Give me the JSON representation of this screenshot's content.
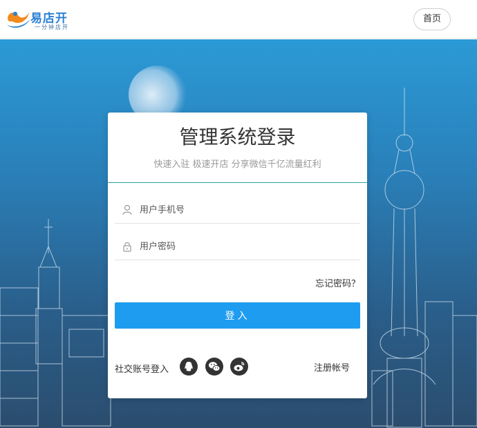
{
  "header": {
    "logo_title": "易店开",
    "logo_subtitle": "一分钟店开",
    "home_label": "首页"
  },
  "login": {
    "title": "管理系统登录",
    "subtitle": "快速入驻 极速开店 分享微信千亿流量红利",
    "username_placeholder": "用户手机号",
    "password_placeholder": "用户密码",
    "forgot_label": "忘记密码？",
    "login_label": "登入",
    "social_label": "社交账号登入",
    "register_label": "注册帐号"
  },
  "colors": {
    "accent": "#1e9cf0",
    "divider": "#2aa39b",
    "hero_top": "#2b9ad6",
    "hero_bottom": "#2b4d6e"
  },
  "icons": {
    "username": "user-icon",
    "password": "lock-icon",
    "qq": "qq-icon",
    "wechat": "wechat-icon",
    "weibo": "weibo-icon"
  }
}
